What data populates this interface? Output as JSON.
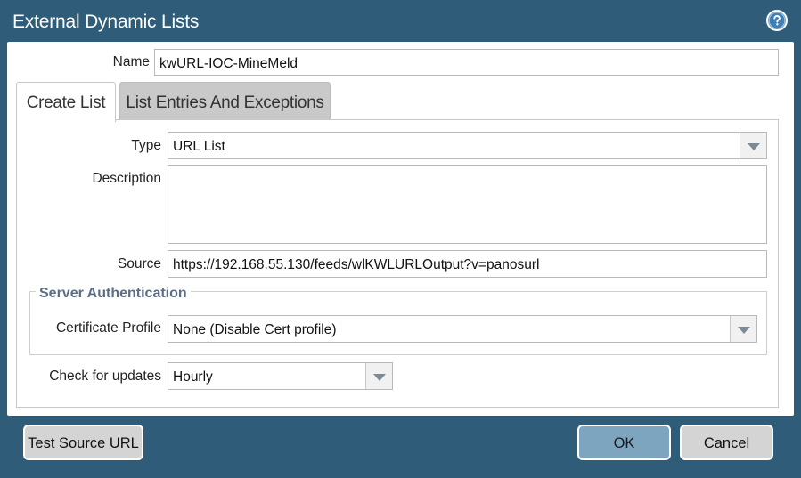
{
  "dialog": {
    "title": "External Dynamic Lists",
    "help_icon": "question-circle-icon"
  },
  "form": {
    "name_label": "Name",
    "name_value": "kwURL-IOC-MineMeld"
  },
  "tabs": [
    {
      "label": "Create List",
      "active": true
    },
    {
      "label": "List Entries And Exceptions",
      "active": false
    }
  ],
  "create_list": {
    "type_label": "Type",
    "type_value": "URL List",
    "description_label": "Description",
    "description_value": "",
    "source_label": "Source",
    "source_value": "https://192.168.55.130/feeds/wlKWLURLOutput?v=panosurl",
    "server_auth": {
      "legend": "Server Authentication",
      "cert_profile_label": "Certificate Profile",
      "cert_profile_value": "None (Disable Cert profile)"
    },
    "check_updates_label": "Check for updates",
    "check_updates_value": "Hourly"
  },
  "buttons": {
    "test_source": "Test Source URL",
    "ok": "OK",
    "cancel": "Cancel"
  },
  "colors": {
    "frame": "#2f5c79",
    "ok_button": "#7da5bf",
    "legend_text": "#5a6e86"
  }
}
